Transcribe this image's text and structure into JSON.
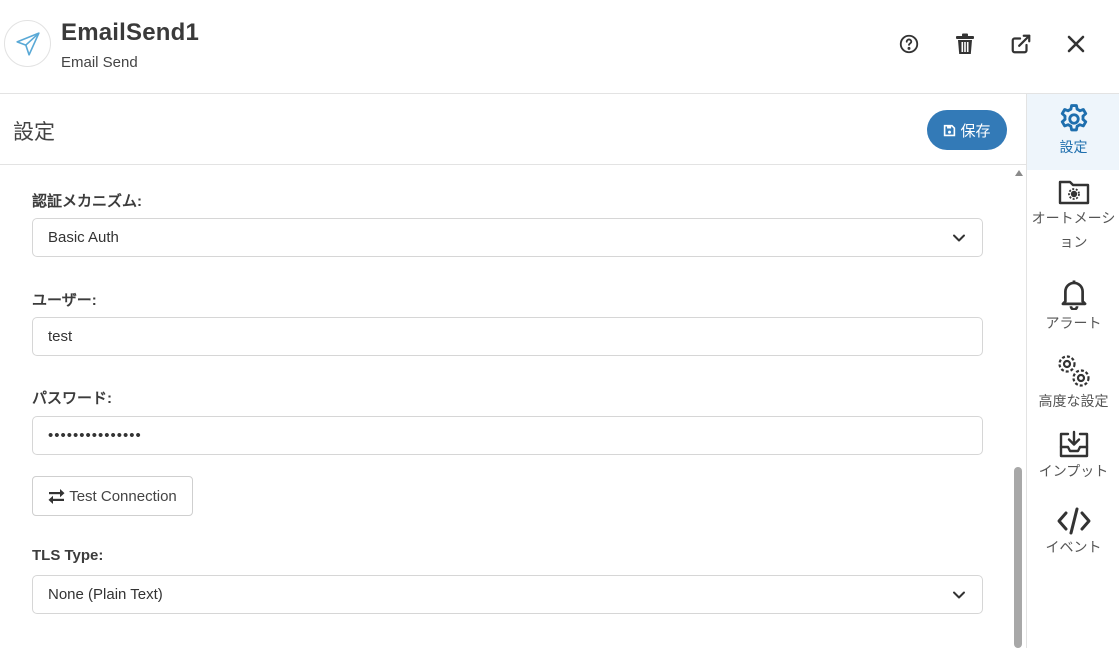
{
  "header": {
    "title": "EmailSend1",
    "subtitle": "Email Send",
    "logo_icon": "paper-plane-icon",
    "buttons": [
      {
        "name": "help-button",
        "icon": "question-circle-icon"
      },
      {
        "name": "delete-button",
        "icon": "trash-icon"
      },
      {
        "name": "open-external-button",
        "icon": "external-link-icon"
      },
      {
        "name": "close-button",
        "icon": "close-icon"
      }
    ]
  },
  "panel": {
    "title": "設定",
    "save_label": "保存",
    "save_icon": "floppy-disk-icon"
  },
  "form": {
    "auth_label": "認証メカニズム:",
    "auth_value": "Basic Auth",
    "user_label": "ユーザー:",
    "user_value": "test",
    "password_label": "パスワード:",
    "password_value": "•••••••••••••••",
    "test_connection_label": "Test Connection",
    "tls_label": "TLS Type:",
    "tls_value": "None (Plain Text)"
  },
  "sidebar": {
    "items": [
      {
        "label": "設定",
        "icon": "gear-icon",
        "active": true
      },
      {
        "label": "オートメーション",
        "icon": "folder-gear-icon",
        "active": false
      },
      {
        "label": "アラート",
        "icon": "bell-icon",
        "active": false
      },
      {
        "label": "高度な設定",
        "icon": "gears-icon",
        "active": false
      },
      {
        "label": "インプット",
        "icon": "inbox-download-icon",
        "active": false
      },
      {
        "label": "イベント",
        "icon": "code-icon",
        "active": false
      }
    ]
  },
  "colors": {
    "accent": "#337ab7",
    "sidebar_active_bg": "#eef5fb",
    "sidebar_active_icon": "#1f6fae"
  }
}
